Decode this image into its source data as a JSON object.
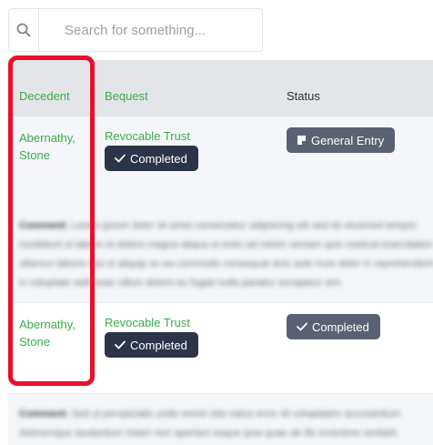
{
  "search": {
    "placeholder": "Search for something...",
    "icon": "search-icon"
  },
  "table": {
    "columns": [
      "Decedent",
      "Bequest",
      "Status"
    ],
    "rows": [
      {
        "decedent": "Abernathy, Stone",
        "bequest_type": "Revocable Trust",
        "bequest_status": "Completed",
        "status": "General Entry",
        "status_icon": "note-icon",
        "comment_label": "Comment:",
        "comment_text": "Lorem ipsum dolor sit amet consectetur adipiscing elit sed do eiusmod tempor incididunt ut labore et dolore magna aliqua ut enim ad minim veniam quis nostrud exercitation ullamco laboris nisi ut aliquip ex ea commodo consequat duis aute irure dolor in reprehenderit in voluptate velit esse cillum dolore eu fugiat nulla pariatur excepteur sint"
      },
      {
        "decedent": "Abernathy, Stone",
        "bequest_type": "Revocable Trust",
        "bequest_status": "Completed",
        "status": "Completed",
        "status_icon": "check-icon",
        "comment_label": "Comment:",
        "comment_text": "Sed ut perspiciatis unde omnis iste natus error sit voluptatem accusantium doloremque laudantium totam rem aperiam eaque ipsa quae ab illo inventore veritatis"
      }
    ]
  },
  "colors": {
    "accent_green": "#3bab4a",
    "badge_dark": "#2c3448",
    "badge_gray": "#5a6172",
    "highlight_red": "#e8102c",
    "header_bg": "#e3e5e8"
  }
}
